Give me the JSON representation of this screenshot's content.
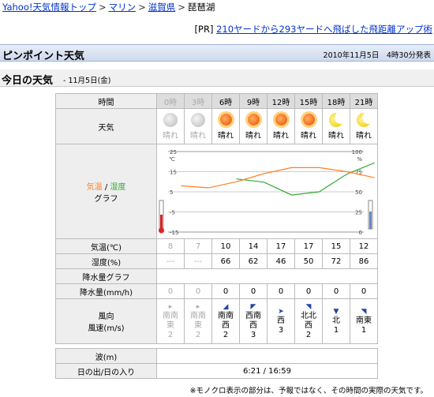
{
  "breadcrumb": {
    "items": [
      "Yahoo!天気情報トップ",
      "マリン",
      "滋賀県"
    ],
    "current": "琵琶湖",
    "separator": ">"
  },
  "ad": {
    "prefix": "[PR]",
    "link_text": "210ヤードから293ヤードへ飛ばした飛距離アップ術"
  },
  "header": {
    "title": "ピンポイント天気",
    "published": "2010年11月5日　4時30分発表"
  },
  "today": {
    "title": "今日の天気",
    "date": "- 11月5日(金)"
  },
  "table": {
    "labels": {
      "time": "時間",
      "weather": "天気",
      "graph_temp": "気温",
      "graph_slash": "/",
      "graph_hum": "湿度",
      "graph_word": "グラフ",
      "temp": "気温(℃)",
      "humidity": "湿度(%)",
      "precip_graph": "降水量グラフ",
      "precip": "降水量(mm/h)",
      "wind_line1": "風向",
      "wind_line2": "風速(m/s)"
    },
    "hours": [
      {
        "time": "0時",
        "past": true,
        "icon": "moon-gray-icon",
        "weather": "晴れ",
        "temp": "8",
        "humidity": "---",
        "precip": "0",
        "wind_arrow": "▸",
        "wind_dir": "南南\n東",
        "wind_speed": "2"
      },
      {
        "time": "3時",
        "past": true,
        "icon": "moon-gray-icon",
        "weather": "晴れ",
        "temp": "7",
        "humidity": "---",
        "precip": "0",
        "wind_arrow": "▸",
        "wind_dir": "南南\n東",
        "wind_speed": "2"
      },
      {
        "time": "6時",
        "past": false,
        "icon": "sun-icon",
        "weather": "晴れ",
        "temp": "10",
        "humidity": "66",
        "precip": "0",
        "wind_arrow": "◢",
        "wind_dir": "南南\n西",
        "wind_speed": "2"
      },
      {
        "time": "9時",
        "past": false,
        "icon": "sun-icon",
        "weather": "晴れ",
        "temp": "14",
        "humidity": "62",
        "precip": "0",
        "wind_arrow": "◤",
        "wind_dir": "西南\n西",
        "wind_speed": "3"
      },
      {
        "time": "12時",
        "past": false,
        "icon": "sun-icon",
        "weather": "晴れ",
        "temp": "17",
        "humidity": "46",
        "precip": "0",
        "wind_arrow": "➤",
        "wind_dir": "西",
        "wind_speed": "3"
      },
      {
        "time": "15時",
        "past": false,
        "icon": "sun-icon",
        "weather": "晴れ",
        "temp": "17",
        "humidity": "50",
        "precip": "0",
        "wind_arrow": "◥",
        "wind_dir": "北北\n西",
        "wind_speed": "2"
      },
      {
        "time": "18時",
        "past": false,
        "icon": "moon-icon",
        "weather": "晴れ",
        "temp": "15",
        "humidity": "72",
        "precip": "0",
        "wind_arrow": "▼",
        "wind_dir": "北",
        "wind_speed": "1"
      },
      {
        "time": "21時",
        "past": false,
        "icon": "moon-icon",
        "weather": "晴れ",
        "temp": "12",
        "humidity": "86",
        "precip": "0",
        "wind_arrow": "◥",
        "wind_dir": "南東",
        "wind_speed": "1"
      }
    ],
    "graph": {
      "temp_ticks": [
        "25",
        "15",
        "5",
        "-5",
        "-15"
      ],
      "temp_unit": "℃",
      "hum_ticks": [
        "100",
        "75",
        "50",
        "25",
        "0"
      ],
      "hum_unit": "%",
      "temp_range": [
        -15,
        25
      ],
      "hum_range": [
        0,
        100
      ],
      "temp_color": "#ff7f27",
      "hum_color": "#33aa33"
    },
    "waves_label": "波(m)",
    "sun_label": "日の出/日の入り",
    "sun_value": "6:21 / 16:59"
  },
  "footnote": "※モノクロ表示の部分は、予報ではなく、その時間の実際の天気です。",
  "colors": {
    "link": "#0033cc",
    "header_band": "#cfdaee",
    "label_bg": "#eeeeee",
    "temp_line": "#ff7f27",
    "humidity_line": "#33aa33"
  }
}
